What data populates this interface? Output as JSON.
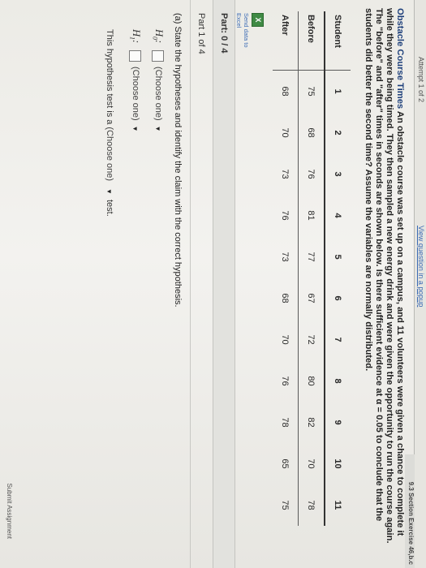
{
  "topbar": {
    "attempt": "Attempt 1 of 2",
    "popup_link": "View question in a popup",
    "section": "9.3 Section Exercise 46,b.c"
  },
  "problem": {
    "title": "Obstacle Course Times",
    "text": "An obstacle course was set up on a campus, and 11 volunteers were given a chance to complete it while they were being timed. They then sampled a new energy drink and were given the opportunity to run the course again. The \"before\" and \"after\" times in seconds are shown below. Is there sufficient evidence at α = 0.05 to conclude that the students did better the second time? Assume the variables are normally distributed."
  },
  "table": {
    "row_labels": [
      "Student",
      "Before",
      "After"
    ],
    "students": [
      "1",
      "2",
      "3",
      "4",
      "5",
      "6",
      "7",
      "8",
      "9",
      "10",
      "11"
    ],
    "before": [
      "75",
      "68",
      "76",
      "81",
      "77",
      "67",
      "72",
      "80",
      "82",
      "70",
      "78"
    ],
    "after": [
      "68",
      "70",
      "73",
      "76",
      "73",
      "68",
      "70",
      "76",
      "78",
      "65",
      "75"
    ]
  },
  "excel": {
    "icon": "excel-icon",
    "label": "Send data to Excel"
  },
  "part": {
    "label": "Part: 0 / 4",
    "of": "Part 1 of 4"
  },
  "question": {
    "prompt": "(a) State the hypotheses and identify the claim with the correct hypothesis.",
    "h0_symbol": "H",
    "h0_sub": "0",
    "h1_symbol": "H",
    "h1_sub": "1",
    "h0_select": "(Choose one)",
    "h1_select": "(Choose one)",
    "test_prefix": "This hypothesis test is a",
    "test_select": "(Choose one)",
    "test_suffix": "test."
  },
  "footer": {
    "submit": "Submit Assignment"
  }
}
